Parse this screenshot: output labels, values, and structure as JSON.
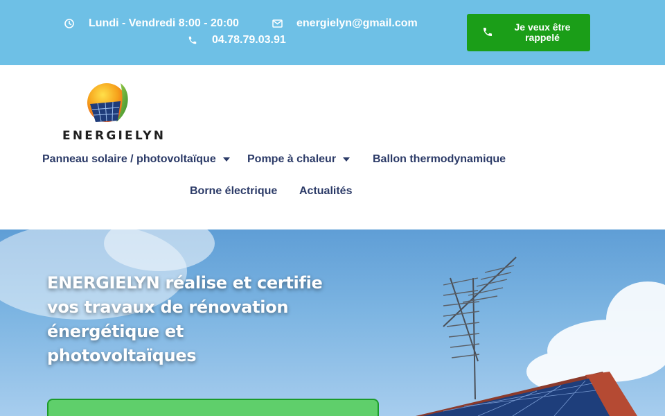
{
  "topbar": {
    "hours_icon": "clock-icon",
    "hours": "Lundi - Vendredi 8:00 - 20:00",
    "email_icon": "envelope-icon",
    "email": "energielyn@gmail.com",
    "phone_icon": "phone-icon",
    "phone": "04.78.79.03.91",
    "callback_label": "Je veux être rappelé",
    "background_color": "#6ec0e6",
    "button_color": "#1b9e18"
  },
  "logo": {
    "wordmark": "ENERGIELYN"
  },
  "nav": {
    "items": [
      {
        "label": "Panneau solaire / photovoltaïque",
        "has_dropdown": true
      },
      {
        "label": "Pompe à chaleur",
        "has_dropdown": true
      },
      {
        "label": "Ballon thermodynamique",
        "has_dropdown": false
      },
      {
        "label": "Borne électrique",
        "has_dropdown": false
      },
      {
        "label": "Actualités",
        "has_dropdown": false
      }
    ],
    "text_color": "#2b3a67"
  },
  "hero": {
    "title": "ENERGIELYN réalise et certifie vos travaux de rénovation énergétique et photovoltaïques",
    "cta_color": "#5fcf6b"
  }
}
